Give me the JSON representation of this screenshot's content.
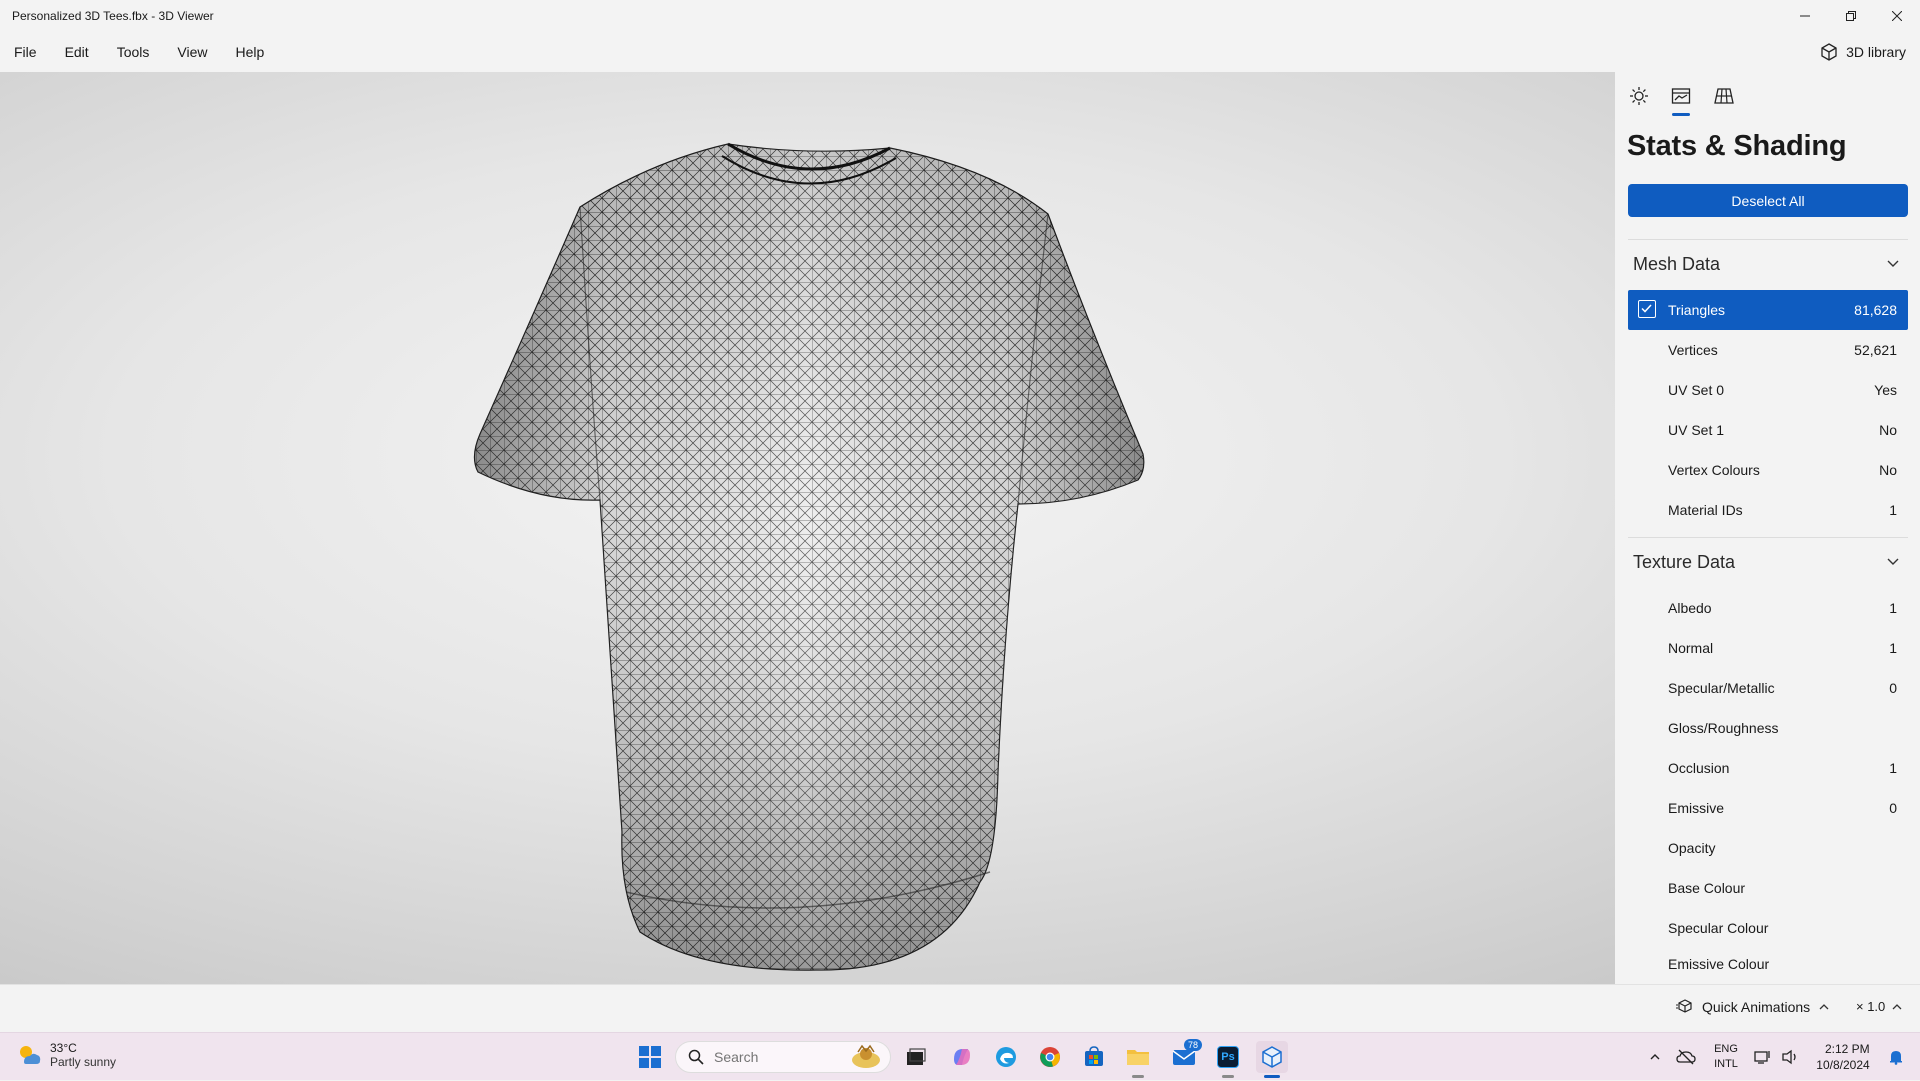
{
  "window": {
    "title": "Personalized 3D Tees.fbx - 3D Viewer"
  },
  "menu": {
    "items": [
      "File",
      "Edit",
      "Tools",
      "View",
      "Help"
    ],
    "library_label": "3D library"
  },
  "panel": {
    "title": "Stats & Shading",
    "deselect_label": "Deselect All",
    "mesh": {
      "heading": "Mesh Data",
      "rows": [
        {
          "name": "Triangles",
          "value": "81,628"
        },
        {
          "name": "Vertices",
          "value": "52,621"
        },
        {
          "name": "UV Set 0",
          "value": "Yes"
        },
        {
          "name": "UV Set 1",
          "value": "No"
        },
        {
          "name": "Vertex Colours",
          "value": "No"
        },
        {
          "name": "Material IDs",
          "value": "1"
        }
      ]
    },
    "texture": {
      "heading": "Texture Data",
      "rows": [
        {
          "name": "Albedo",
          "value": "1"
        },
        {
          "name": "Normal",
          "value": "1"
        },
        {
          "name": "Specular/Metallic",
          "value": "0"
        },
        {
          "name": "Gloss/Roughness",
          "value": ""
        },
        {
          "name": "Occlusion",
          "value": "1"
        },
        {
          "name": "Emissive",
          "value": "0"
        },
        {
          "name": "Opacity",
          "value": ""
        },
        {
          "name": "Base Colour",
          "value": ""
        },
        {
          "name": "Specular Colour",
          "value": ""
        },
        {
          "name": "Emissive Colour",
          "value": ""
        }
      ]
    }
  },
  "statusbar": {
    "quick_animations": "Quick Animations",
    "speed": "× 1.0"
  },
  "taskbar": {
    "weather": {
      "temp": "33°C",
      "desc": "Partly sunny"
    },
    "search_placeholder": "Search",
    "mail_badge": "78",
    "ps_label": "Ps",
    "lang": {
      "line1": "ENG",
      "line2": "INTL"
    },
    "clock": {
      "time": "2:12 PM",
      "date": "10/8/2024"
    }
  },
  "colors": {
    "accent": "#0f5cc0",
    "taskbar": "#f0e4ee"
  }
}
